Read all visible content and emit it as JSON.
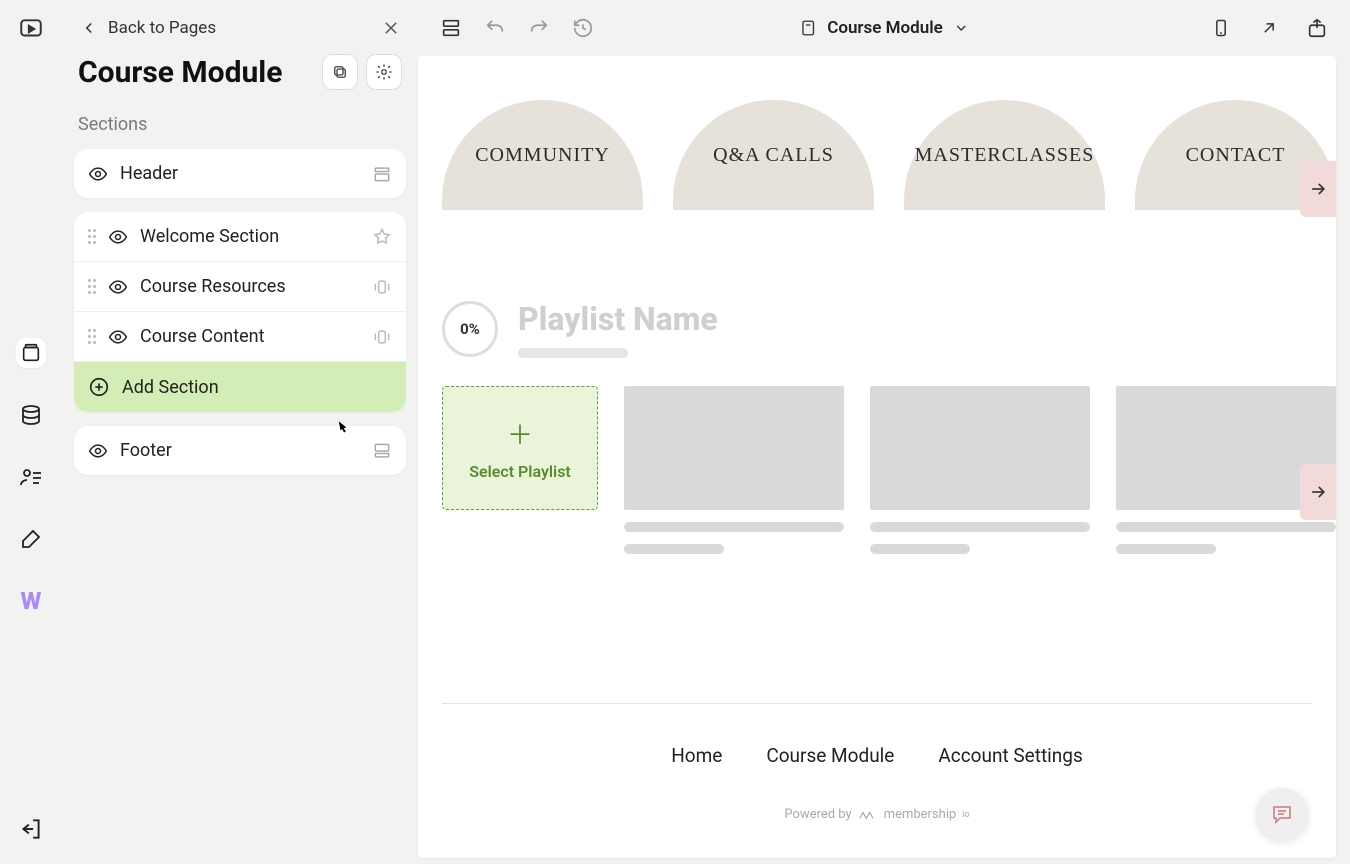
{
  "sidebar": {
    "back_label": "Back to Pages",
    "page_title": "Course Module",
    "sections_label": "Sections",
    "items": {
      "header": "Header",
      "welcome": "Welcome Section",
      "resources": "Course Resources",
      "content": "Course Content",
      "add": "Add Section",
      "footer": "Footer"
    }
  },
  "topbar": {
    "page_name": "Course Module"
  },
  "canvas": {
    "nav": [
      "COMMUNITY",
      "Q&A CALLS",
      "MASTERCLASSES",
      "CONTACT"
    ],
    "playlist": {
      "percent": "0%",
      "title": "Playlist Name",
      "select_label": "Select Playlist"
    },
    "footer_links": [
      "Home",
      "Course Module",
      "Account Settings"
    ],
    "powered_prefix": "Powered by",
    "powered_brand": "membership"
  }
}
